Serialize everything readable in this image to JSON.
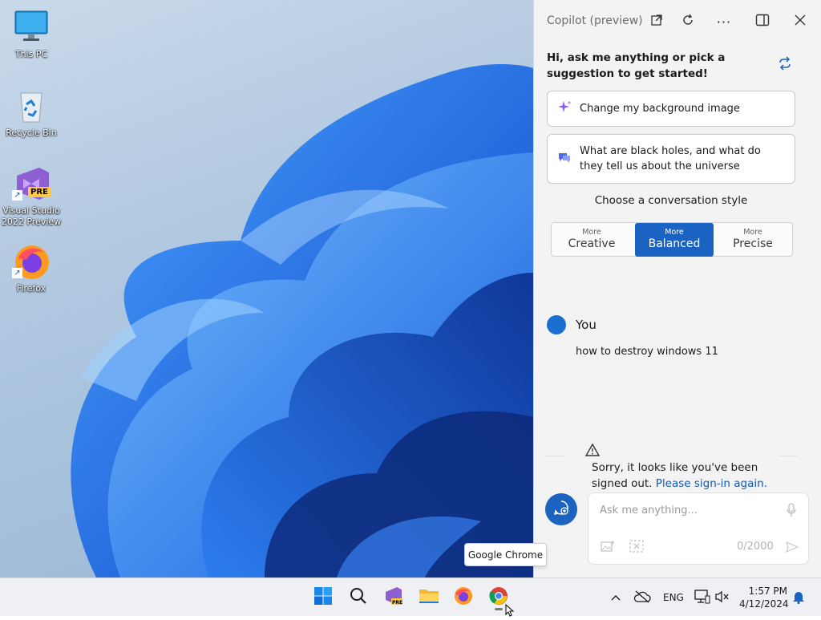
{
  "desktop": {
    "icons": [
      {
        "label": "This PC",
        "icon": "monitor-icon"
      },
      {
        "label": "Recycle Bin",
        "icon": "recycle-bin-icon"
      },
      {
        "label": "Visual Studio 2022 Preview",
        "icon": "visual-studio-icon",
        "badge": "PRE"
      },
      {
        "label": "Firefox",
        "icon": "firefox-icon"
      }
    ]
  },
  "copilot": {
    "title": "Copilot (preview)",
    "greeting": "Hi, ask me anything or pick a suggestion to get started!",
    "suggestions": [
      {
        "text": "Change my background image",
        "icon": "sparkle-icon"
      },
      {
        "text": "What are black holes, and what do they tell us about the universe",
        "icon": "chat-bubble-icon"
      }
    ],
    "style_label": "Choose a conversation style",
    "styles": [
      {
        "small": "More",
        "big": "Creative",
        "active": false
      },
      {
        "small": "More",
        "big": "Balanced",
        "active": true
      },
      {
        "small": "More",
        "big": "Precise",
        "active": false
      }
    ],
    "user_name": "You",
    "user_message": "how to destroy windows 11",
    "warning_text": "Sorry, it looks like you've been signed out.",
    "warning_link": "Please sign-in again.",
    "input_placeholder": "Ask me anything...",
    "char_counter": "0/2000",
    "accent": "#1a63c2"
  },
  "tooltip": "Google Chrome",
  "taskbar": {
    "apps": [
      "windows-start-icon",
      "search-icon",
      "visual-studio-icon",
      "file-explorer-icon",
      "firefox-icon",
      "chrome-icon"
    ],
    "language": "ENG",
    "time": "1:57 PM",
    "date": "4/12/2024"
  }
}
